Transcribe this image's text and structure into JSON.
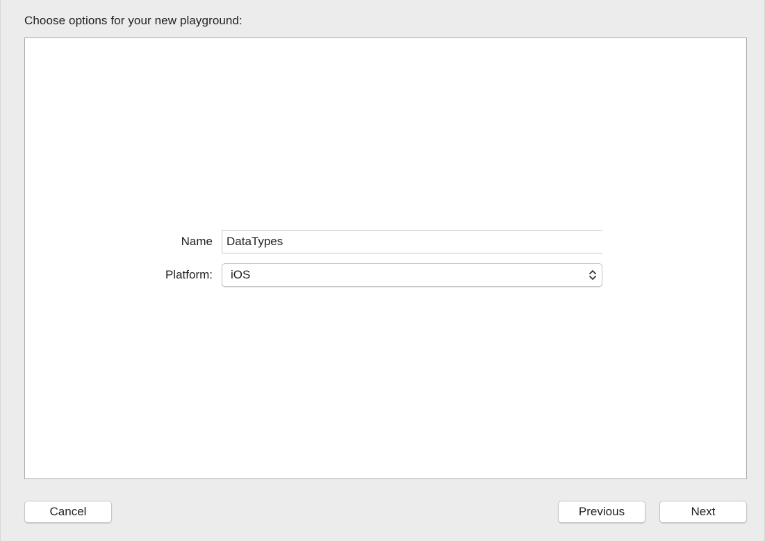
{
  "dialog": {
    "heading": "Choose options for your new playground:"
  },
  "form": {
    "name_label": "Name",
    "name_value": "DataTypes",
    "platform_label": "Platform:",
    "platform_value": "iOS",
    "platform_icon": "chevron-up-down-icon"
  },
  "footer": {
    "cancel_label": "Cancel",
    "previous_label": "Previous",
    "next_label": "Next"
  }
}
